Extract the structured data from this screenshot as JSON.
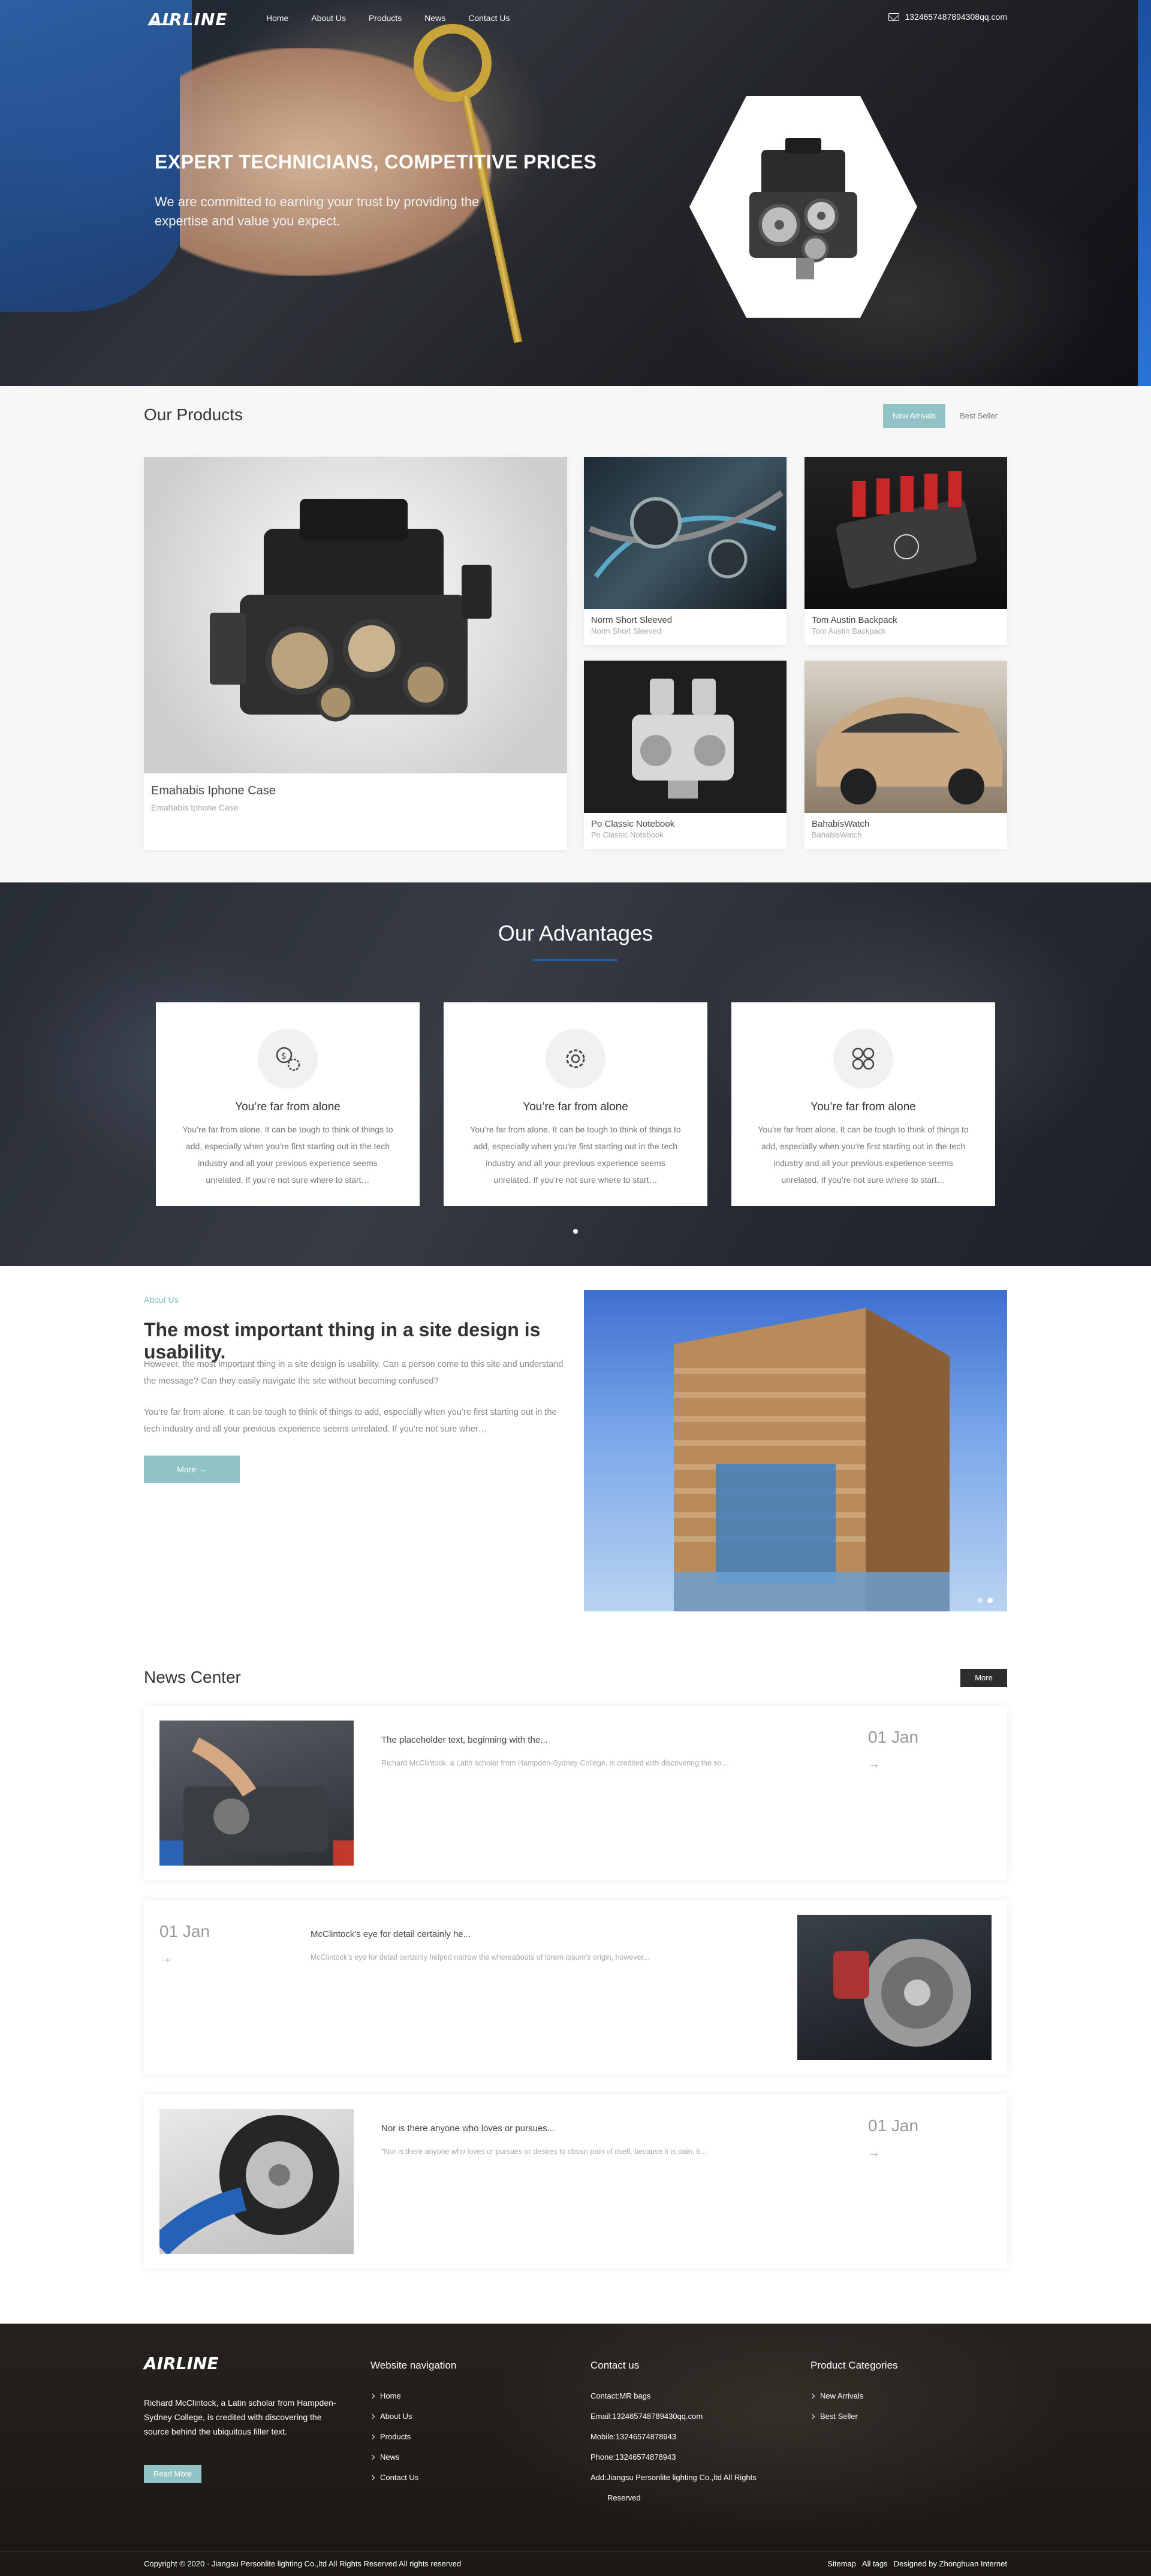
{
  "nav": {
    "logo": "AIRLINE",
    "links": [
      "Home",
      "About Us",
      "Products",
      "News",
      "Contact Us"
    ],
    "email": "1324657487894308qq.com"
  },
  "hero": {
    "title": "EXPERT TECHNICIANS, COMPETITIVE PRICES",
    "subtitle": "We are committed to earning your trust by providing the expertise and value you expect."
  },
  "products": {
    "heading": "Our Products",
    "tabs": [
      "New Arrivals",
      "Best Seller"
    ],
    "items": [
      {
        "title": "Emahabis Iphone Case",
        "subtitle": "Emahabis Iphone Case"
      },
      {
        "title": "Norm Short Sleeved",
        "subtitle": "Norm Short Sleeved"
      },
      {
        "title": "Tom Austin Backpack",
        "subtitle": "Tom Austin Backpack"
      },
      {
        "title": "Po Classic Notebook",
        "subtitle": "Po Classic Notebook"
      },
      {
        "title": "BahabisWatch",
        "subtitle": "BahabisWatch"
      }
    ]
  },
  "advantages": {
    "heading": "Our Advantages",
    "cards": [
      {
        "icon": "money-gear-icon",
        "title": "You’re far from alone",
        "body": "You’re far from alone. It can be tough to think of things to add, especially when you’re first starting out in the tech industry and all your previous experience seems unrelated. If you’re not sure where to start…"
      },
      {
        "icon": "gear-icon",
        "title": "You’re far from alone",
        "body": "You’re far from alone. It can be tough to think of things to add, especially when you’re first starting out in the tech industry and all your previous experience seems unrelated. If you’re not sure where to start…"
      },
      {
        "icon": "gears-network-icon",
        "title": "You’re far from alone",
        "body": "You’re far from alone. It can be tough to think of things to add, especially when you’re first starting out in the tech industry and all your previous experience seems unrelated. If you’re not sure where to start…"
      }
    ]
  },
  "about": {
    "kicker": "About Us",
    "title": "The most important thing in a site design is usability.",
    "p1": "However, the most important thing in a site design is usability. Can a person come to this site and understand the message? Can they easily navigate the site without becoming confused?",
    "p2": "You’re far from alone. It can be tough to think of things to add, especially when you’re first starting out in the tech industry and all your previous experience seems unrelated. If you’re not sure wher…",
    "button": "More  →"
  },
  "news": {
    "heading": "News Center",
    "more": "More",
    "items": [
      {
        "title": "The placeholder text, beginning with the...",
        "desc": "Richard McClintock, a Latin scholar from Hampden-Sydney College, is credited with discovering the so...",
        "date": "01 Jan",
        "arrow": "→"
      },
      {
        "title": "McClintock's eye for detail certainly he...",
        "desc": "McClintock's eye for detail certainly helped narrow the whereabouts of lorem ipsum's origin, however...",
        "date": "01 Jan",
        "arrow": "→"
      },
      {
        "title": "Nor is there anyone who loves or pursues...",
        "desc": "\"Nor is there anyone who loves or pursues or desires to obtain pain of itself, because it is pain, b...",
        "date": "01 Jan",
        "arrow": "→"
      }
    ]
  },
  "footer": {
    "logo": "AIRLINE",
    "about": "Richard McClintock, a Latin scholar from Hampden-Sydney College, is credited with discovering the source behind the ubiquitous filler text.",
    "read_more": "Read More",
    "nav_heading": "Website navigation",
    "nav_links": [
      "Home",
      "About Us",
      "Products",
      "News",
      "Contact Us"
    ],
    "contact_heading": "Contact us",
    "contact_lines": [
      "Contact:MR bags",
      "Email:132465748789430qq.com",
      "Mobile:13246574878943",
      "Phone:13246574878943",
      "Add:Jiangsu Personlite lighting Co.,ltd All Rights",
      "Reserved"
    ],
    "cat_heading": "Product Categories",
    "cat_links": [
      "New Arrivals",
      "Best Seller"
    ],
    "copyright": "Copyright © 2020 ·   Jiangsu Personlite lighting Co.,ltd All Rights Reserved  All rights reserved",
    "bottom_links": [
      "Sitemap",
      "All tags",
      "Designed by Zhonghuan Internet"
    ]
  }
}
